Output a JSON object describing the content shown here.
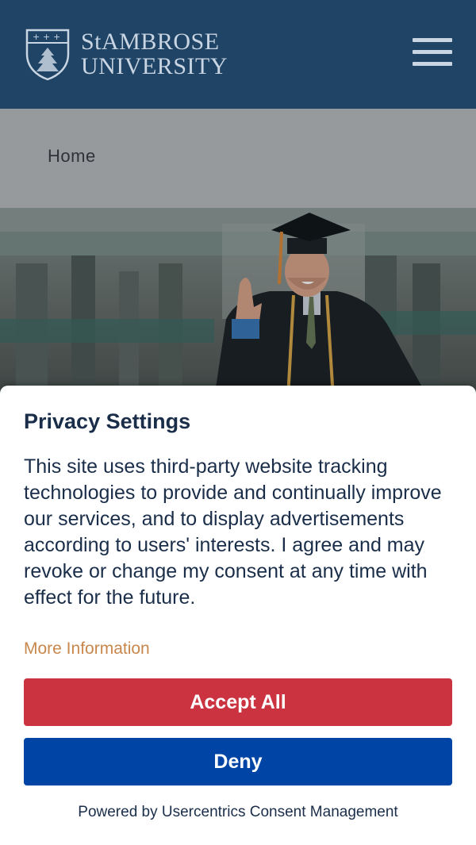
{
  "header": {
    "brand_line1": "StAMBROSE",
    "brand_line2": "UNIVERSITY",
    "logo_icon": "crest-icon",
    "menu_icon": "hamburger-menu-icon",
    "background_color": "#1f4466"
  },
  "breadcrumb": {
    "home_label": "Home"
  },
  "consent": {
    "title": "Privacy Settings",
    "body": "This site uses third-party website tracking technologies to provide and continually improve our services, and to display advertisements according to users' interests. I agree and may revoke or change my consent at any time with effect for the future.",
    "more_info_label": "More Information",
    "accept_label": "Accept All",
    "deny_label": "Deny",
    "powered_by": "Powered by Usercentrics Consent Management",
    "accept_color": "#cb3341",
    "deny_color": "#0045a6",
    "link_color": "#c8874c"
  }
}
